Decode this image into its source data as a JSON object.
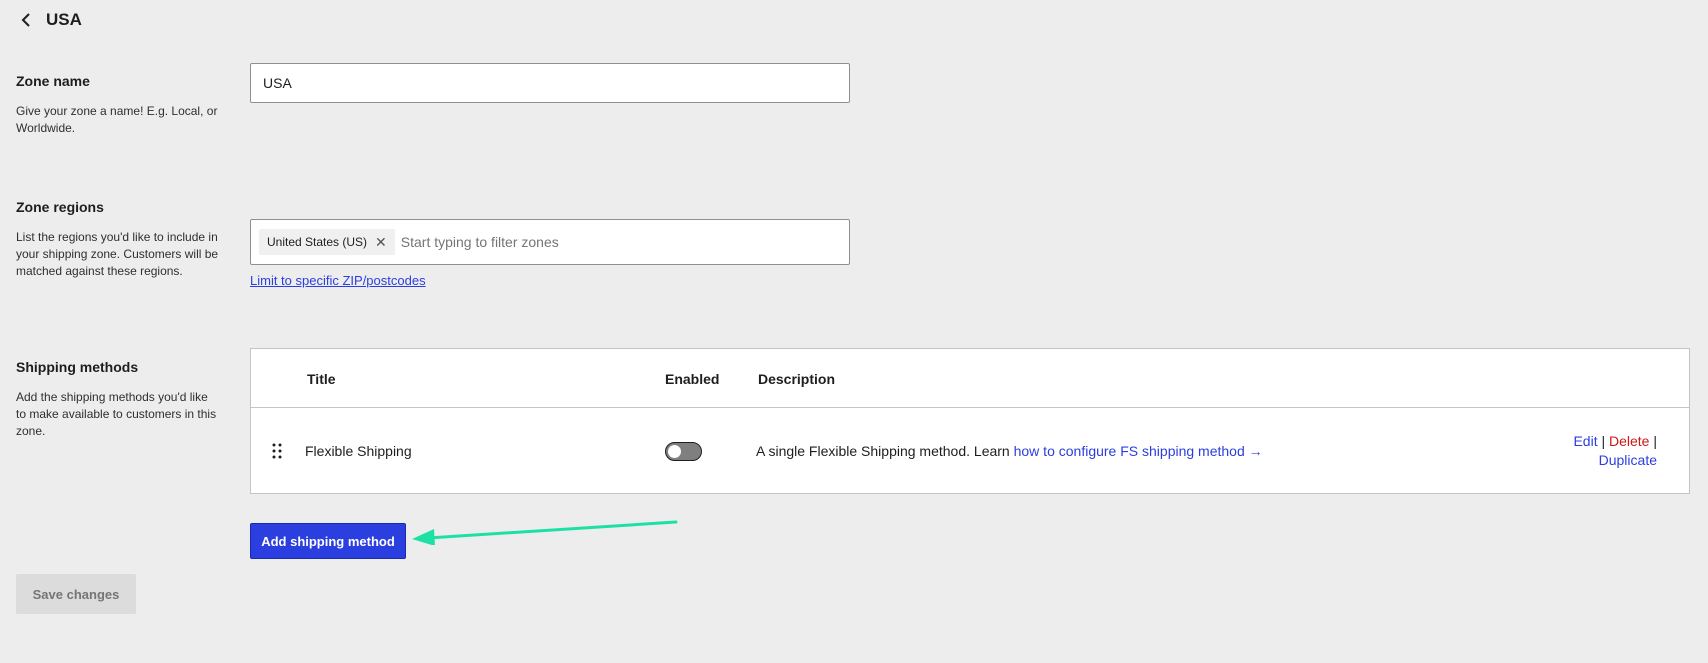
{
  "header": {
    "title": "USA",
    "back_icon": "chevron-left-icon"
  },
  "zone_name": {
    "label": "Zone name",
    "help": "Give your zone a name! E.g. Local, or Worldwide.",
    "value": "USA"
  },
  "zone_regions": {
    "label": "Zone regions",
    "help": "List the regions you'd like to include in your shipping zone. Customers will be matched against these regions.",
    "chips": [
      {
        "label": "United States (US)",
        "remove_glyph": "✕"
      }
    ],
    "placeholder": "Start typing to filter zones",
    "zip_link": "Limit to specific ZIP/postcodes"
  },
  "shipping_methods": {
    "label": "Shipping methods",
    "help": "Add the shipping methods you'd like to make available to customers in this zone.",
    "columns": {
      "title": "Title",
      "enabled": "Enabled",
      "description": "Description"
    },
    "rows": [
      {
        "title": "Flexible Shipping",
        "enabled": false,
        "description": "A single Flexible Shipping method. Learn ",
        "description_link": "how to configure FS shipping method →",
        "actions": {
          "edit": "Edit",
          "delete": "Delete",
          "duplicate": "Duplicate",
          "separator": "|"
        }
      }
    ],
    "add_button": "Add shipping method"
  },
  "footer": {
    "save_button": "Save changes"
  },
  "colors": {
    "accent": "#2b3ee0",
    "danger": "#cc1818",
    "annotation_arrow": "#1de1a4",
    "background": "#ededed"
  }
}
